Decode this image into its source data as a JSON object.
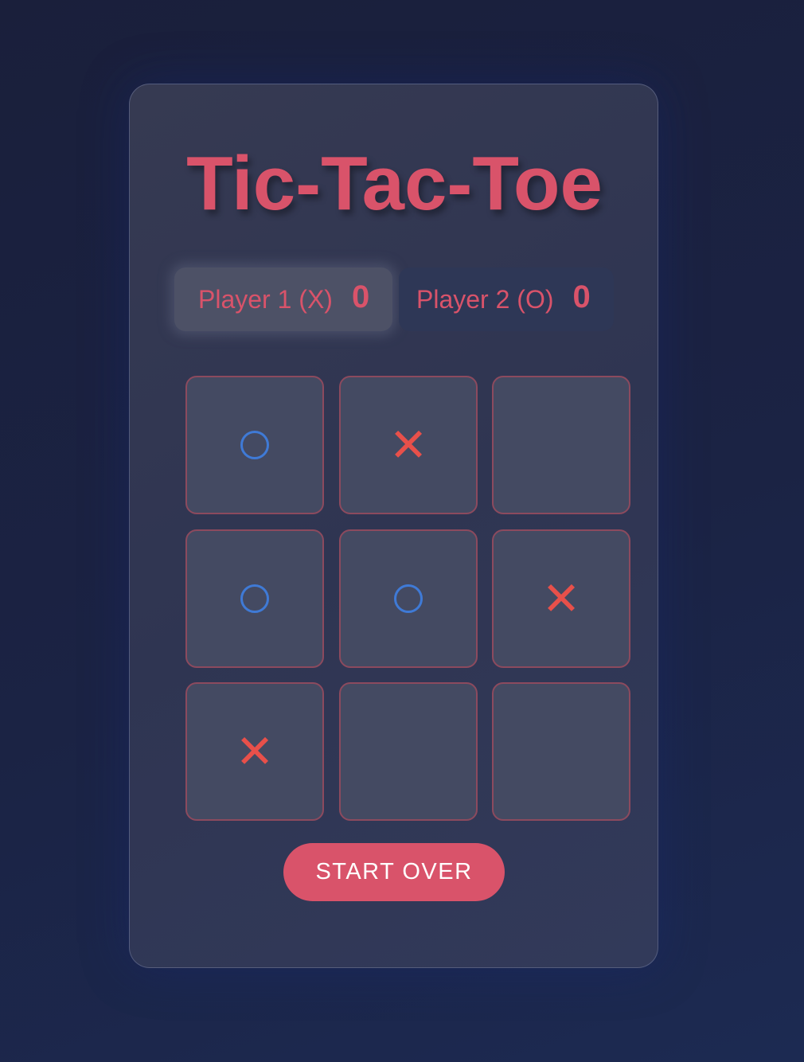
{
  "game": {
    "title": "Tic-Tac-Toe"
  },
  "scoreboard": {
    "player1": {
      "label": "Player 1 (X)",
      "score": "0",
      "active": true
    },
    "player2": {
      "label": "Player 2 (O)",
      "score": "0",
      "active": false
    }
  },
  "board": {
    "cells": [
      "O",
      "X",
      "",
      "O",
      "O",
      "X",
      "X",
      "",
      ""
    ]
  },
  "controls": {
    "start_over_label": "START OVER"
  },
  "colors": {
    "accent": "#d9536a",
    "x_mark": "#e8504a",
    "o_mark": "#3f7ad6",
    "cell_border": "#8c4a5e"
  }
}
